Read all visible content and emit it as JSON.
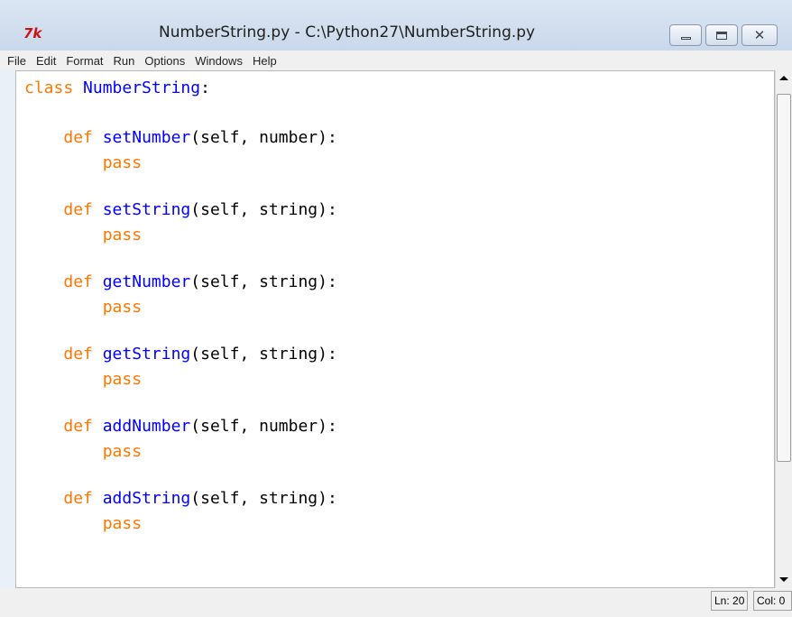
{
  "window": {
    "title": "NumberString.py - C:\\Python27\\NumberString.py",
    "icon": "tk-feather-icon",
    "icon_text": "7k",
    "close_glyph": "✕"
  },
  "menu": [
    "File",
    "Edit",
    "Format",
    "Run",
    "Options",
    "Windows",
    "Help"
  ],
  "colors": {
    "keyword": "#ff7700",
    "definition": "#0000ff",
    "text": "#000000"
  },
  "code": {
    "line1": {
      "kw": "class",
      "name": "NumberString",
      "rest": ":"
    },
    "line2": {
      "kw": "def",
      "name": "setNumber",
      "rest": "(self, number):"
    },
    "line3": {
      "kw": "pass"
    },
    "line4": {
      "kw": "def",
      "name": "setString",
      "rest": "(self, string):"
    },
    "line5": {
      "kw": "pass"
    },
    "line6": {
      "kw": "def",
      "name": "getNumber",
      "rest": "(self, string):"
    },
    "line7": {
      "kw": "pass"
    },
    "line8": {
      "kw": "def",
      "name": "getString",
      "rest": "(self, string):"
    },
    "line9": {
      "kw": "pass"
    },
    "line10": {
      "kw": "def",
      "name": "addNumber",
      "rest": "(self, number):"
    },
    "line11": {
      "kw": "pass"
    },
    "line12": {
      "kw": "def",
      "name": "addString",
      "rest": "(self, string):"
    },
    "line13": {
      "kw": "pass"
    }
  },
  "status": {
    "line": "Ln: 20",
    "col": "Col: 0"
  }
}
